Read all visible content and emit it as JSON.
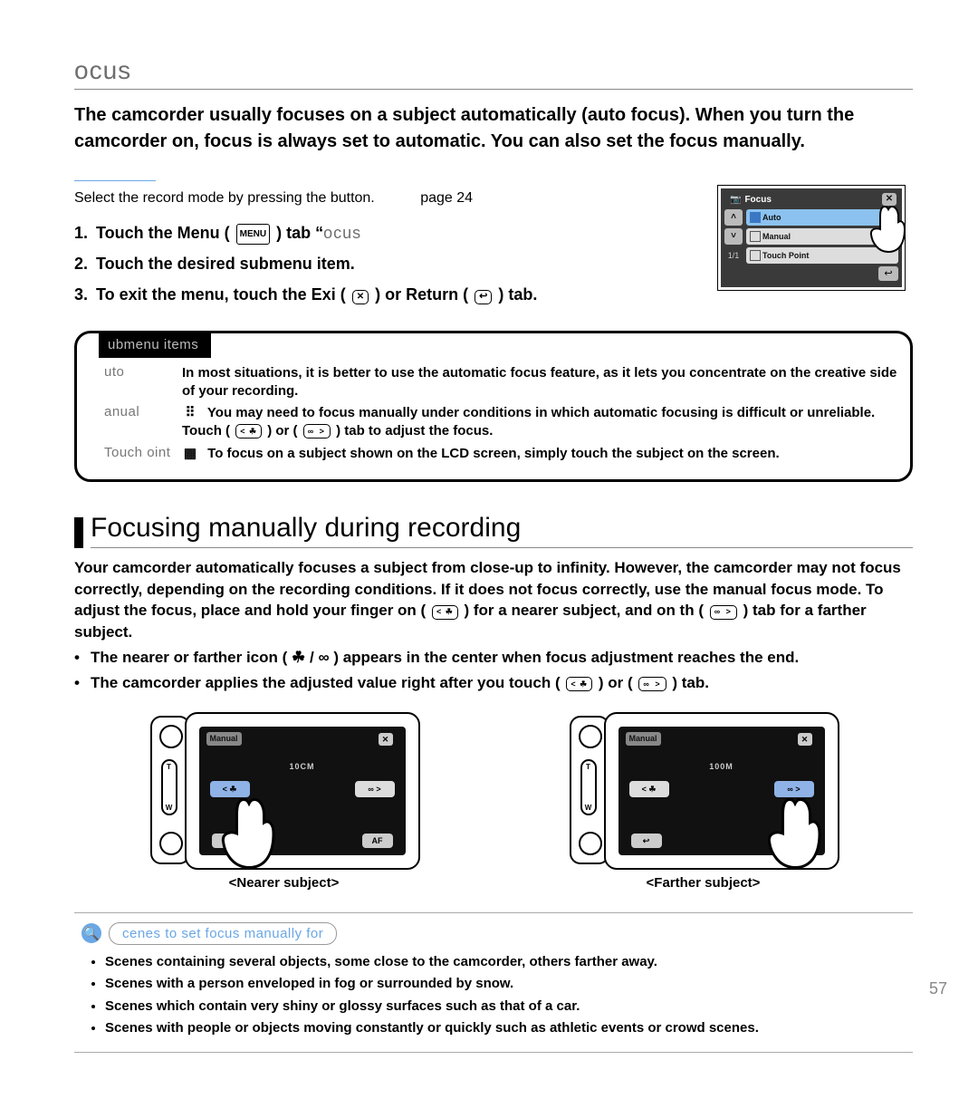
{
  "section_title": "ocus",
  "intro": "The camcorder usually focuses on a subject automatically (auto focus). When you turn the camcorder on, focus is always set to automatic. You can also set the focus manually.",
  "precheck": {
    "text": "Select the record mode by pressing the  button.",
    "pageref": "page 24"
  },
  "steps": [
    {
      "num": "1.",
      "a": "Touch the Menu (",
      "b": ") tab ",
      "quote": "“",
      "tail": "ocus"
    },
    {
      "num": "2.",
      "a": "Touch the desired submenu item."
    },
    {
      "num": "3.",
      "a": "To exit the menu, touch the Exi (",
      "mid": ") or Return (",
      "b": ") tab."
    }
  ],
  "submenu": {
    "tab": "ubmenu items",
    "rows": [
      {
        "key": "uto",
        "icon": "",
        "val": "In most situations, it is better to use the automatic focus feature, as it lets you concentrate on the creative side of your recording."
      },
      {
        "key": "anual",
        "icon": "⠿",
        "val_a": "You may need to focus manually under conditions in which automatic focusing is difficult or unreliable. Touch (",
        "val_b": ") or (",
        "val_c": ") tab to adjust the focus."
      },
      {
        "key": "Touch oint",
        "icon": "▦",
        "val": "To focus on a subject shown on the LCD screen, simply touch the subject on the screen."
      }
    ]
  },
  "h2": "Focusing manually during recording",
  "body": {
    "p_a": "Your camcorder automatically focuses a subject from close-up to infinity. However, the camcorder may not focus correctly, depending on the recording conditions. If it does not focus correctly, use the manual focus mode. To adjust the focus, place and hold your finger on (",
    "p_b": ") for a nearer subject, and on th (",
    "p_c": ") tab for a farther subject.",
    "b1_a": "The nearer or farther icon (",
    "b1_mid": " / ",
    "b1_b": ") appears in the center when focus adjustment reaches the end.",
    "b2_a": "The camcorder applies the adjusted value right after you touch (",
    "b2_b": ") or (",
    "b2_c": ") tab."
  },
  "lcd": {
    "manual_label": "Manual",
    "dist_near": "10CM",
    "dist_far": "100M",
    "near_btn": "< ☘",
    "far_btn": "∞ >",
    "af": "AF",
    "ret": "↩",
    "tw": "T",
    "caption_near": "<Nearer subject>",
    "caption_far": "<Farther subject>"
  },
  "focus_menu": {
    "title": "Focus",
    "items": [
      "Auto",
      "Manual",
      "Touch Point"
    ],
    "page": "1/1"
  },
  "tips": {
    "title": "cenes to set focus manually for",
    "items": [
      "Scenes containing several objects, some close to the camcorder, others farther away.",
      "Scenes with a person enveloped in fog or surrounded by snow.",
      "Scenes which contain very shiny or glossy surfaces such as that of a car.",
      "Scenes with people or objects moving constantly or quickly such as athletic events or crowd scenes."
    ]
  },
  "page_num": "57",
  "icons": {
    "menu": "MENU",
    "near_glyph": "☘",
    "far_glyph": "∞"
  }
}
